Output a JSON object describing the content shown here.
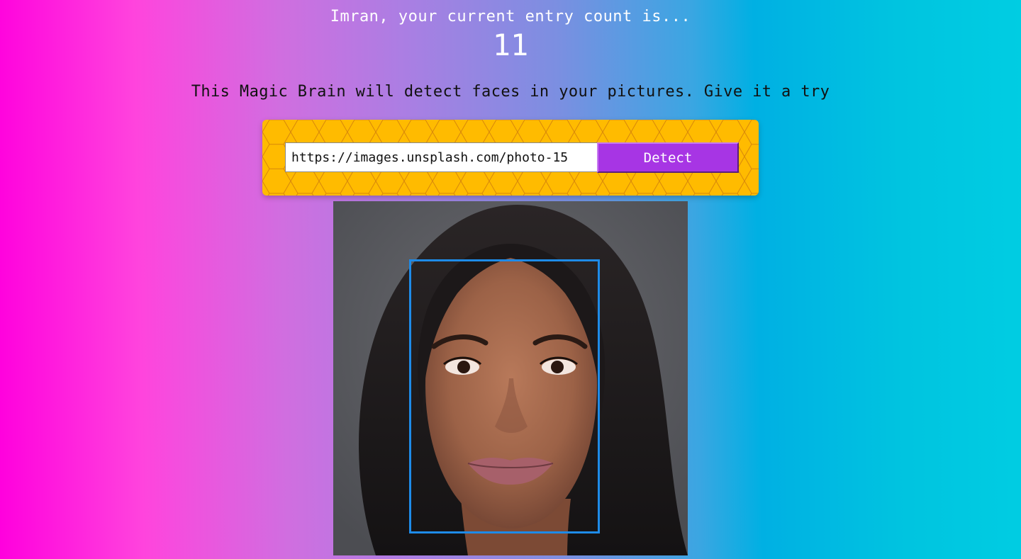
{
  "header": {
    "greeting": "Imran, your current entry count is...",
    "entry_count": "11"
  },
  "tagline": "This Magic Brain will detect faces in your pictures. Give it a try",
  "form": {
    "url_value": "https://images.unsplash.com/photo-15",
    "detect_label": "Detect"
  },
  "colors": {
    "panel": "#ffbb00",
    "button": "#a735e4",
    "face_box": "#1e8be8"
  },
  "image": {
    "alt": "Portrait photo with detected face"
  }
}
